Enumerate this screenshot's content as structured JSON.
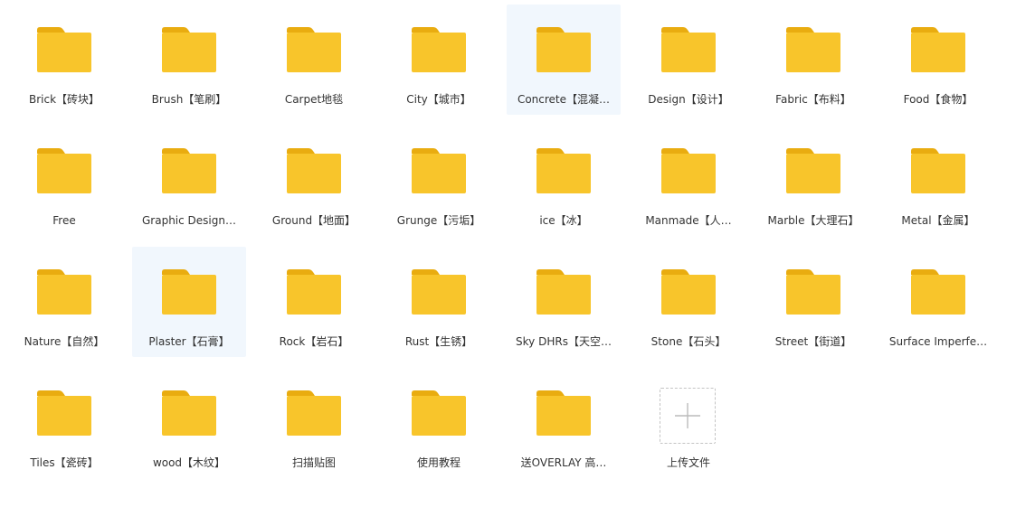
{
  "colors": {
    "folder_body": "#f8c52b",
    "folder_tab": "#e9ac10",
    "selected_bg": "#f1f7fd",
    "text": "#333333",
    "upload_border": "#c4c4c4",
    "upload_plus": "#bbbbbb"
  },
  "folders": [
    {
      "label": "Brick【砖块】",
      "icon": "folder-icon",
      "selected": false
    },
    {
      "label": "Brush【笔刷】",
      "icon": "folder-icon",
      "selected": false
    },
    {
      "label": "Carpet地毯",
      "icon": "folder-icon",
      "selected": false
    },
    {
      "label": "City【城市】",
      "icon": "folder-icon",
      "selected": false
    },
    {
      "label": "Concrete【混凝…",
      "icon": "folder-icon",
      "selected": true
    },
    {
      "label": "Design【设计】",
      "icon": "folder-icon",
      "selected": false
    },
    {
      "label": "Fabric【布料】",
      "icon": "folder-icon",
      "selected": false
    },
    {
      "label": "Food【食物】",
      "icon": "folder-icon",
      "selected": false
    },
    {
      "label": "Free",
      "icon": "folder-icon",
      "selected": false
    },
    {
      "label": "Graphic Design…",
      "icon": "folder-icon",
      "selected": false
    },
    {
      "label": "Ground【地面】",
      "icon": "folder-icon",
      "selected": false
    },
    {
      "label": "Grunge【污垢】",
      "icon": "folder-icon",
      "selected": false
    },
    {
      "label": "ice【冰】",
      "icon": "folder-icon",
      "selected": false
    },
    {
      "label": "Manmade【人…",
      "icon": "folder-icon",
      "selected": false
    },
    {
      "label": "Marble【大理石】",
      "icon": "folder-icon",
      "selected": false
    },
    {
      "label": "Metal【金属】",
      "icon": "folder-icon",
      "selected": false
    },
    {
      "label": "Nature【自然】",
      "icon": "folder-icon",
      "selected": false
    },
    {
      "label": "Plaster【石膏】",
      "icon": "folder-icon",
      "selected": true
    },
    {
      "label": "Rock【岩石】",
      "icon": "folder-icon",
      "selected": false
    },
    {
      "label": "Rust【生锈】",
      "icon": "folder-icon",
      "selected": false
    },
    {
      "label": "Sky DHRs【天空…",
      "icon": "folder-icon",
      "selected": false
    },
    {
      "label": "Stone【石头】",
      "icon": "folder-icon",
      "selected": false
    },
    {
      "label": "Street【街道】",
      "icon": "folder-icon",
      "selected": false
    },
    {
      "label": "Surface Imperfe…",
      "icon": "folder-icon",
      "selected": false
    },
    {
      "label": "Tiles【瓷砖】",
      "icon": "folder-icon",
      "selected": false
    },
    {
      "label": "wood【木纹】",
      "icon": "folder-icon",
      "selected": false
    },
    {
      "label": "扫描贴图",
      "icon": "folder-icon",
      "selected": false
    },
    {
      "label": "使用教程",
      "icon": "folder-icon",
      "selected": false
    },
    {
      "label": "送OVERLAY 高…",
      "icon": "folder-icon",
      "selected": false
    }
  ],
  "upload": {
    "label": "上传文件",
    "icon": "plus-icon"
  }
}
